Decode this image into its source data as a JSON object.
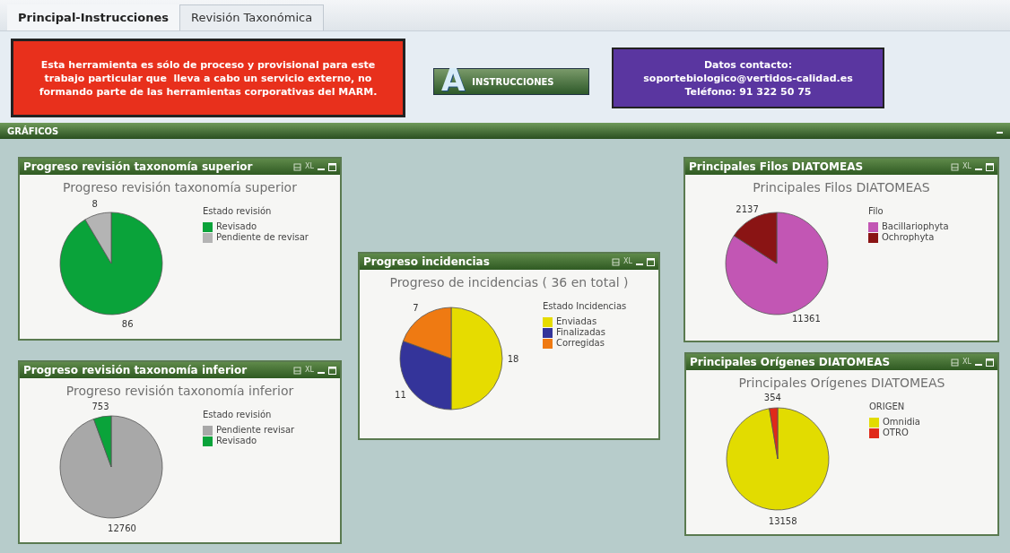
{
  "tabs": [
    {
      "label": "Principal-Instrucciones",
      "selected": true
    },
    {
      "label": "Revisión Taxonómica",
      "selected": false
    }
  ],
  "notice": {
    "lines": [
      "Esta herramienta es sólo de proceso y provisional para este",
      "trabajo particular que  lleva a cabo un servicio externo, no",
      "formando parte de las herramientas corporativas del MARM."
    ]
  },
  "instructions_button": {
    "icon_letter": "A",
    "label": "INSTRUCCIONES"
  },
  "contact": {
    "lines": [
      "Datos contacto:",
      "soportebiologico@vertidos-calidad.es",
      "Teléfono: 91 322 50 75"
    ]
  },
  "section": {
    "title": "GRÁFICOS"
  },
  "panels": [
    {
      "title": "Progreso revisión taxonomía superior",
      "xl": "XL",
      "chart_data": {
        "type": "pie",
        "title": "Progreso revisión taxonomía superior",
        "legend_title": "Estado revisión",
        "categories": [
          "Revisado",
          "Pendiente de revisar"
        ],
        "values": [
          86,
          8
        ],
        "colors": [
          "#0aa33a",
          "#b4b4b4"
        ],
        "data_labels": true
      }
    },
    {
      "title": "Progreso revisión taxonomía inferior",
      "xl": "XL",
      "chart_data": {
        "type": "pie",
        "title": "Progreso revisión taxonomía inferior",
        "legend_title": "Estado revisión",
        "categories": [
          "Pendiente revisar",
          "Revisado"
        ],
        "values": [
          12760,
          753
        ],
        "colors": [
          "#a8a8a8",
          "#0aa33a"
        ],
        "data_labels": true
      }
    },
    {
      "title": "Progreso incidencias",
      "xl": "XL",
      "chart_data": {
        "type": "pie",
        "title": "Progreso de incidencias ( 36  en total )",
        "legend_title": "Estado Incidencias",
        "categories": [
          "Enviadas",
          "Finalizadas",
          "Corregidas"
        ],
        "values": [
          18,
          11,
          7
        ],
        "colors": [
          "#e6dc00",
          "#34349a",
          "#ef7a12"
        ],
        "data_labels": true
      }
    },
    {
      "title": "Principales Filos DIATOMEAS",
      "xl": "XL",
      "chart_data": {
        "type": "pie",
        "title": "Principales Filos DIATOMEAS",
        "legend_title": "Filo",
        "categories": [
          "Bacillariophyta",
          "Ochrophyta"
        ],
        "values": [
          11361,
          2137
        ],
        "colors": [
          "#c256b4",
          "#8a1414"
        ],
        "data_labels": true
      }
    },
    {
      "title": "Principales Orígenes DIATOMEAS",
      "xl": "XL",
      "chart_data": {
        "type": "pie",
        "title": "Principales Orígenes DIATOMEAS",
        "legend_title": "ORIGEN",
        "categories": [
          "Omnidia",
          "OTRO"
        ],
        "values": [
          13158,
          354
        ],
        "colors": [
          "#e2dc00",
          "#e02a1a"
        ],
        "data_labels": true
      }
    }
  ]
}
